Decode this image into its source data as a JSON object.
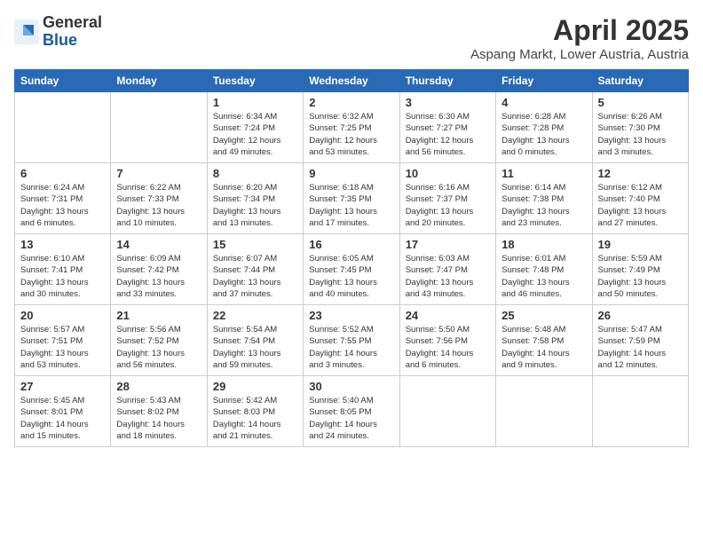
{
  "header": {
    "logo_general": "General",
    "logo_blue": "Blue",
    "month": "April 2025",
    "location": "Aspang Markt, Lower Austria, Austria"
  },
  "days_of_week": [
    "Sunday",
    "Monday",
    "Tuesday",
    "Wednesday",
    "Thursday",
    "Friday",
    "Saturday"
  ],
  "weeks": [
    [
      {
        "day": "",
        "info": ""
      },
      {
        "day": "",
        "info": ""
      },
      {
        "day": "1",
        "info": "Sunrise: 6:34 AM\nSunset: 7:24 PM\nDaylight: 12 hours\nand 49 minutes."
      },
      {
        "day": "2",
        "info": "Sunrise: 6:32 AM\nSunset: 7:25 PM\nDaylight: 12 hours\nand 53 minutes."
      },
      {
        "day": "3",
        "info": "Sunrise: 6:30 AM\nSunset: 7:27 PM\nDaylight: 12 hours\nand 56 minutes."
      },
      {
        "day": "4",
        "info": "Sunrise: 6:28 AM\nSunset: 7:28 PM\nDaylight: 13 hours\nand 0 minutes."
      },
      {
        "day": "5",
        "info": "Sunrise: 6:26 AM\nSunset: 7:30 PM\nDaylight: 13 hours\nand 3 minutes."
      }
    ],
    [
      {
        "day": "6",
        "info": "Sunrise: 6:24 AM\nSunset: 7:31 PM\nDaylight: 13 hours\nand 6 minutes."
      },
      {
        "day": "7",
        "info": "Sunrise: 6:22 AM\nSunset: 7:33 PM\nDaylight: 13 hours\nand 10 minutes."
      },
      {
        "day": "8",
        "info": "Sunrise: 6:20 AM\nSunset: 7:34 PM\nDaylight: 13 hours\nand 13 minutes."
      },
      {
        "day": "9",
        "info": "Sunrise: 6:18 AM\nSunset: 7:35 PM\nDaylight: 13 hours\nand 17 minutes."
      },
      {
        "day": "10",
        "info": "Sunrise: 6:16 AM\nSunset: 7:37 PM\nDaylight: 13 hours\nand 20 minutes."
      },
      {
        "day": "11",
        "info": "Sunrise: 6:14 AM\nSunset: 7:38 PM\nDaylight: 13 hours\nand 23 minutes."
      },
      {
        "day": "12",
        "info": "Sunrise: 6:12 AM\nSunset: 7:40 PM\nDaylight: 13 hours\nand 27 minutes."
      }
    ],
    [
      {
        "day": "13",
        "info": "Sunrise: 6:10 AM\nSunset: 7:41 PM\nDaylight: 13 hours\nand 30 minutes."
      },
      {
        "day": "14",
        "info": "Sunrise: 6:09 AM\nSunset: 7:42 PM\nDaylight: 13 hours\nand 33 minutes."
      },
      {
        "day": "15",
        "info": "Sunrise: 6:07 AM\nSunset: 7:44 PM\nDaylight: 13 hours\nand 37 minutes."
      },
      {
        "day": "16",
        "info": "Sunrise: 6:05 AM\nSunset: 7:45 PM\nDaylight: 13 hours\nand 40 minutes."
      },
      {
        "day": "17",
        "info": "Sunrise: 6:03 AM\nSunset: 7:47 PM\nDaylight: 13 hours\nand 43 minutes."
      },
      {
        "day": "18",
        "info": "Sunrise: 6:01 AM\nSunset: 7:48 PM\nDaylight: 13 hours\nand 46 minutes."
      },
      {
        "day": "19",
        "info": "Sunrise: 5:59 AM\nSunset: 7:49 PM\nDaylight: 13 hours\nand 50 minutes."
      }
    ],
    [
      {
        "day": "20",
        "info": "Sunrise: 5:57 AM\nSunset: 7:51 PM\nDaylight: 13 hours\nand 53 minutes."
      },
      {
        "day": "21",
        "info": "Sunrise: 5:56 AM\nSunset: 7:52 PM\nDaylight: 13 hours\nand 56 minutes."
      },
      {
        "day": "22",
        "info": "Sunrise: 5:54 AM\nSunset: 7:54 PM\nDaylight: 13 hours\nand 59 minutes."
      },
      {
        "day": "23",
        "info": "Sunrise: 5:52 AM\nSunset: 7:55 PM\nDaylight: 14 hours\nand 3 minutes."
      },
      {
        "day": "24",
        "info": "Sunrise: 5:50 AM\nSunset: 7:56 PM\nDaylight: 14 hours\nand 6 minutes."
      },
      {
        "day": "25",
        "info": "Sunrise: 5:48 AM\nSunset: 7:58 PM\nDaylight: 14 hours\nand 9 minutes."
      },
      {
        "day": "26",
        "info": "Sunrise: 5:47 AM\nSunset: 7:59 PM\nDaylight: 14 hours\nand 12 minutes."
      }
    ],
    [
      {
        "day": "27",
        "info": "Sunrise: 5:45 AM\nSunset: 8:01 PM\nDaylight: 14 hours\nand 15 minutes."
      },
      {
        "day": "28",
        "info": "Sunrise: 5:43 AM\nSunset: 8:02 PM\nDaylight: 14 hours\nand 18 minutes."
      },
      {
        "day": "29",
        "info": "Sunrise: 5:42 AM\nSunset: 8:03 PM\nDaylight: 14 hours\nand 21 minutes."
      },
      {
        "day": "30",
        "info": "Sunrise: 5:40 AM\nSunset: 8:05 PM\nDaylight: 14 hours\nand 24 minutes."
      },
      {
        "day": "",
        "info": ""
      },
      {
        "day": "",
        "info": ""
      },
      {
        "day": "",
        "info": ""
      }
    ]
  ]
}
